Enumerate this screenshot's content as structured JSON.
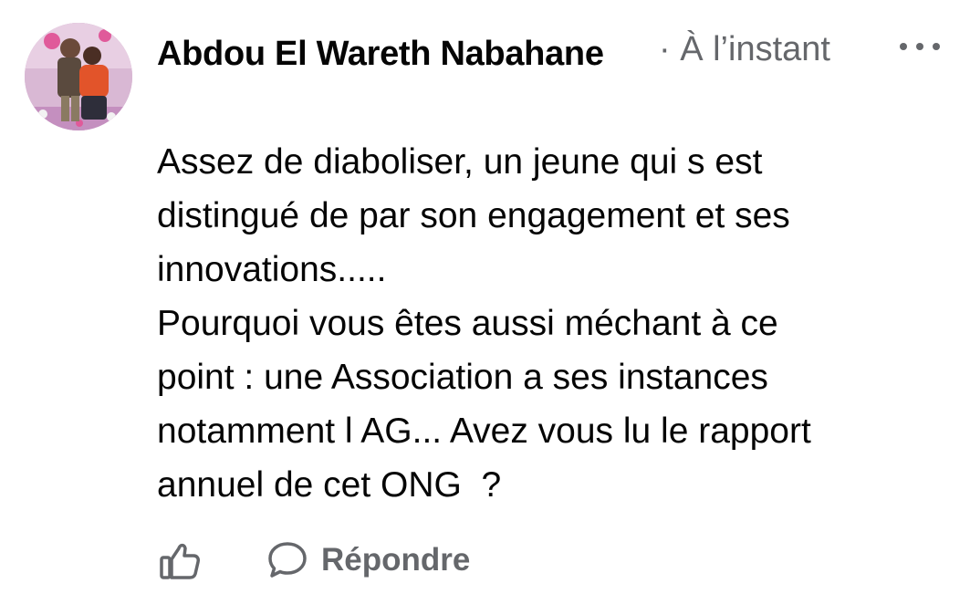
{
  "comment": {
    "author": "Abdou El Wareth Nabahane",
    "timestamp": "· À l’instant",
    "text": "Assez de diaboliser, un jeune qui s est\ndistingué de par son engagement et ses\ninnovations.....\nPourquoi vous êtes aussi méchant à ce\npoint : une Association a ses instances\nnotamment l AG... Avez vous lu le rapport\nannuel de cet ONG  ?",
    "avatar_icon": "avatar-photo-icon",
    "more_icon": "more-dots-icon"
  },
  "actions": {
    "like_icon": "thumbs-up-icon",
    "reply_icon": "speech-bubble-icon",
    "reply_label": "Répondre"
  },
  "colors": {
    "text": "#050505",
    "secondary": "#65676b",
    "background": "#ffffff"
  }
}
